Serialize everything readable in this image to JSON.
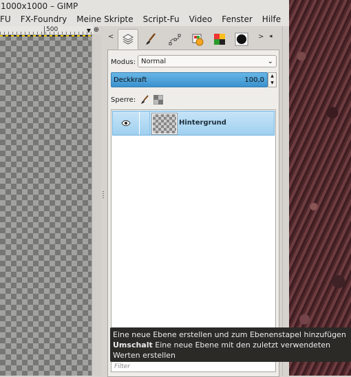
{
  "window": {
    "title": "1000x1000 – GIMP"
  },
  "menubar": {
    "items": [
      "FU",
      "FX-Foundry",
      "Meine Skripte",
      "Script-Fu",
      "Video",
      "Fenster",
      "Hilfe"
    ]
  },
  "ruler": {
    "label": "500"
  },
  "dock": {
    "tabs": [
      {
        "icon": "layers-icon",
        "active": true
      },
      {
        "icon": "paintbrush-icon"
      },
      {
        "icon": "paths-icon"
      },
      {
        "icon": "undo-history-icon"
      },
      {
        "icon": "colors-icon"
      },
      {
        "icon": "brushes-icon"
      }
    ],
    "layers": {
      "mode_label": "Modus:",
      "mode_value": "Normal",
      "opacity_label": "Deckkraft",
      "opacity_value": "100,0",
      "lock_label": "Sperre:",
      "list": [
        {
          "name": "Hintergrund",
          "visible": true,
          "selected": true
        }
      ],
      "buttons": [
        "new-layer-icon",
        "new-layer-group-icon",
        "raise-layer-icon",
        "lower-layer-icon",
        "duplicate-layer-icon",
        "anchor-layer-icon",
        "delete-layer-icon"
      ],
      "filter_placeholder": "Filter"
    }
  },
  "tooltip": {
    "line1": "Eine neue Ebene erstellen und zum Ebenenstapel hinzufügen",
    "shortcut": "Umschalt",
    "line2_rest": " Eine neue Ebene mit den zuletzt verwendeten",
    "line3": "Werten erstellen"
  },
  "colors": {
    "selection": "#9fd0f0",
    "opacity_bar": "#3b92cf",
    "tooltip_bg": "#2b2a27",
    "delete_red": "#d42020"
  }
}
